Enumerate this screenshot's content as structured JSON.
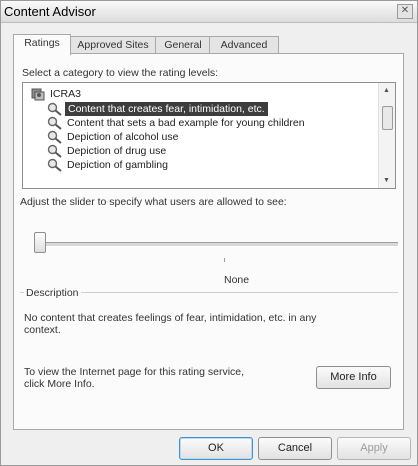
{
  "window": {
    "title": "Content Advisor",
    "close_glyph": "✕"
  },
  "tabs": [
    {
      "label": "Ratings",
      "active": true
    },
    {
      "label": "Approved Sites",
      "active": false
    },
    {
      "label": "General",
      "active": false
    },
    {
      "label": "Advanced",
      "active": false
    }
  ],
  "ratings": {
    "category_prompt": "Select a category to view the rating levels:",
    "tree": {
      "root": {
        "label": "ICRA3",
        "icon": "rating-system-icon"
      },
      "items": [
        {
          "label": "Content that creates fear, intimidation, etc.",
          "selected": true,
          "icon": "magnifier-icon"
        },
        {
          "label": "Content that sets a bad example for young children",
          "selected": false,
          "icon": "magnifier-icon"
        },
        {
          "label": "Depiction of alcohol use",
          "selected": false,
          "icon": "magnifier-icon"
        },
        {
          "label": "Depiction of drug use",
          "selected": false,
          "icon": "magnifier-icon"
        },
        {
          "label": "Depiction of gambling",
          "selected": false,
          "icon": "magnifier-icon"
        }
      ]
    },
    "slider_prompt": "Adjust the slider to specify what users are allowed to see:",
    "slider_level_label": "None",
    "slider_position": 0,
    "description_heading": "Description",
    "description_text_line1": "No content that creates feelings of fear, intimidation, etc. in any",
    "description_text_line2": "context.",
    "info_text_line1": "To view the Internet page for this rating service,",
    "info_text_line2": "click More Info.",
    "more_info_label": "More Info"
  },
  "buttons": {
    "ok": "OK",
    "cancel": "Cancel",
    "apply": "Apply"
  },
  "colors": {
    "selection": "#3d3d3d",
    "default_button_border": "#4a90c8"
  }
}
